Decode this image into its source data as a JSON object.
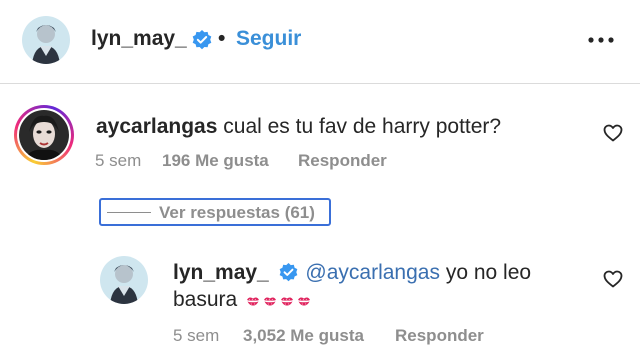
{
  "header": {
    "username": "lyn_may_",
    "separator": "•",
    "follow_label": "Seguir"
  },
  "comment": {
    "username": "aycarlangas",
    "text": "cual es tu fav de harry potter?",
    "time": "5 sem",
    "likes": "196 Me gusta",
    "reply_label": "Responder"
  },
  "view_replies": {
    "label": "Ver respuestas (61)"
  },
  "reply": {
    "username": "lyn_may_",
    "mention": "@aycarlangas",
    "text_line1": " yo no leo",
    "text_line2": "basura",
    "emoji_count": 4,
    "time": "5 sem",
    "likes": "3,052 Me gusta",
    "reply_label": "Responder"
  },
  "colors": {
    "follow": "#3a8fd8",
    "verified": "#3897f0",
    "mention": "#3a6fb0",
    "meta": "#8e8e8e",
    "kiss": "#e0245e"
  },
  "icons": [
    "verified-badge-icon",
    "more-options-icon",
    "heart-icon",
    "kiss-mark-icon"
  ]
}
